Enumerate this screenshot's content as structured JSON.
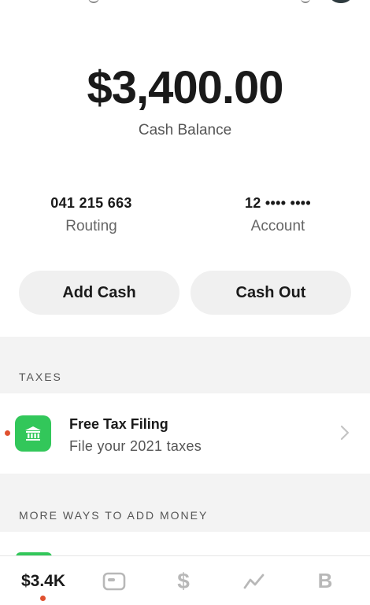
{
  "balance": {
    "amount": "$3,400.00",
    "label": "Cash Balance"
  },
  "routing": {
    "number": "041 215 663",
    "label": "Routing"
  },
  "account": {
    "number": "12 •••• ••••",
    "label": "Account"
  },
  "actions": {
    "add_cash": "Add Cash",
    "cash_out": "Cash Out"
  },
  "sections": {
    "taxes_title": "TAXES",
    "more_ways_title": "MORE WAYS TO ADD MONEY"
  },
  "tax_item": {
    "title": "Free Tax Filing",
    "subtitle": "File your 2021 taxes",
    "icon": "bank-icon"
  },
  "nav": {
    "balance": "$3.4K",
    "dollar": "$",
    "bitcoin": "B",
    "icons": [
      "card-icon",
      "dollar-icon",
      "investing-icon",
      "bitcoin-icon"
    ]
  },
  "colors": {
    "accent_green": "#32c75a",
    "notification_red": "#e0512f",
    "pill_bg": "#f0f0f0",
    "section_bg": "#f3f3f3"
  }
}
